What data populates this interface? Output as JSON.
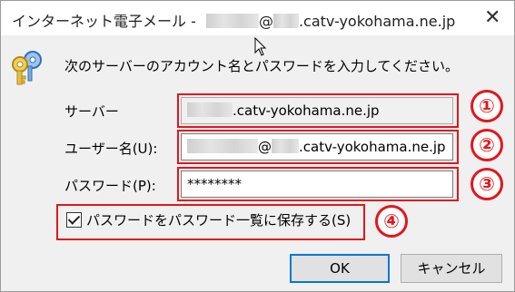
{
  "window": {
    "title_prefix": "インターネット電子メール -",
    "title_at": "@",
    "title_domain": ".catv-yokohama.ne.jp",
    "close_glyph": "✕"
  },
  "instruction": "次のサーバーのアカウント名とパスワードを入力してください。",
  "server": {
    "label": "サーバー",
    "value": ".catv-yokohama.ne.jp"
  },
  "username": {
    "label": "ユーザー名(U):",
    "at": "@",
    "value": ".catv-yokohama.ne.jp"
  },
  "password": {
    "label": "パスワード(P):",
    "value": "********"
  },
  "remember": {
    "label": "パスワードをパスワード一覧に保存する(S)",
    "checked": true
  },
  "buttons": {
    "ok": "OK",
    "cancel": "キャンセル"
  },
  "annotations": [
    "①",
    "②",
    "③",
    "④"
  ],
  "colors": {
    "annotation_red": "#e3161c",
    "default_button_border": "#0078d7"
  }
}
